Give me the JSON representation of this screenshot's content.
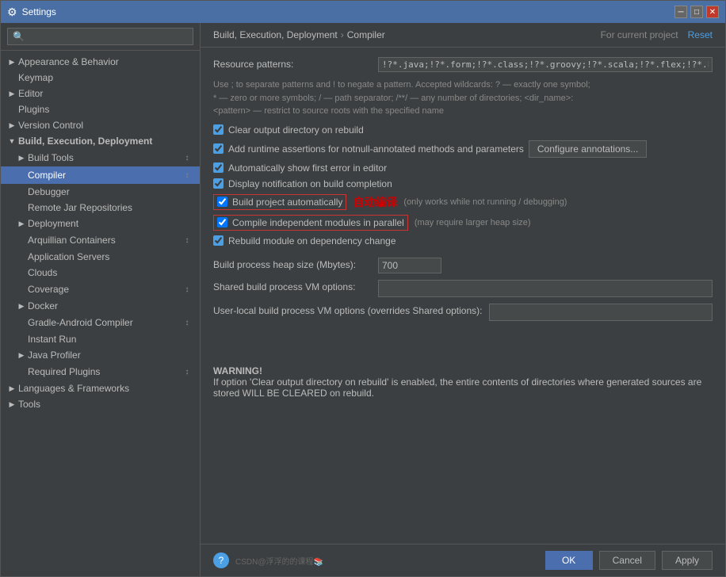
{
  "window": {
    "title": "Settings",
    "icon": "⚙"
  },
  "sidebar": {
    "search": {
      "placeholder": "🔍"
    },
    "items": [
      {
        "id": "appearance",
        "label": "Appearance & Behavior",
        "level": 0,
        "arrow": "closed",
        "selected": false
      },
      {
        "id": "keymap",
        "label": "Keymap",
        "level": 0,
        "arrow": "empty",
        "selected": false
      },
      {
        "id": "editor",
        "label": "Editor",
        "level": 0,
        "arrow": "closed",
        "selected": false
      },
      {
        "id": "plugins",
        "label": "Plugins",
        "level": 0,
        "arrow": "empty",
        "selected": false
      },
      {
        "id": "version-control",
        "label": "Version Control",
        "level": 0,
        "arrow": "closed",
        "selected": false
      },
      {
        "id": "build-exec",
        "label": "Build, Execution, Deployment",
        "level": 0,
        "arrow": "open",
        "selected": false,
        "bold": true
      },
      {
        "id": "build-tools",
        "label": "Build Tools",
        "level": 1,
        "arrow": "closed",
        "selected": false,
        "sync": true
      },
      {
        "id": "compiler",
        "label": "Compiler",
        "level": 1,
        "arrow": "empty",
        "selected": true,
        "sync": true
      },
      {
        "id": "debugger",
        "label": "Debugger",
        "level": 1,
        "arrow": "empty",
        "selected": false
      },
      {
        "id": "remote-jar",
        "label": "Remote Jar Repositories",
        "level": 1,
        "arrow": "empty",
        "selected": false
      },
      {
        "id": "deployment",
        "label": "Deployment",
        "level": 1,
        "arrow": "closed",
        "selected": false
      },
      {
        "id": "arquillian",
        "label": "Arquillian Containers",
        "level": 1,
        "arrow": "empty",
        "selected": false,
        "sync": true
      },
      {
        "id": "app-servers",
        "label": "Application Servers",
        "level": 1,
        "arrow": "empty",
        "selected": false
      },
      {
        "id": "clouds",
        "label": "Clouds",
        "level": 1,
        "arrow": "empty",
        "selected": false
      },
      {
        "id": "coverage",
        "label": "Coverage",
        "level": 1,
        "arrow": "empty",
        "selected": false,
        "sync": true
      },
      {
        "id": "docker",
        "label": "Docker",
        "level": 1,
        "arrow": "closed",
        "selected": false
      },
      {
        "id": "gradle-android",
        "label": "Gradle-Android Compiler",
        "level": 1,
        "arrow": "empty",
        "selected": false,
        "sync": true
      },
      {
        "id": "instant-run",
        "label": "Instant Run",
        "level": 1,
        "arrow": "empty",
        "selected": false
      },
      {
        "id": "java-profiler",
        "label": "Java Profiler",
        "level": 1,
        "arrow": "closed",
        "selected": false
      },
      {
        "id": "required-plugins",
        "label": "Required Plugins",
        "level": 1,
        "arrow": "empty",
        "selected": false,
        "sync": true
      },
      {
        "id": "languages",
        "label": "Languages & Frameworks",
        "level": 0,
        "arrow": "closed",
        "selected": false
      },
      {
        "id": "tools",
        "label": "Tools",
        "level": 0,
        "arrow": "closed",
        "selected": false
      }
    ]
  },
  "header": {
    "breadcrumb1": "Build, Execution, Deployment",
    "arrow": "›",
    "breadcrumb2": "Compiler",
    "for_project": "For current project",
    "reset": "Reset"
  },
  "form": {
    "resource_patterns_label": "Resource patterns:",
    "resource_patterns_value": "!?*.java;!?*.form;!?*.class;!?*.groovy;!?*.scala;!?*.flex;!?*.kt;!?*.clj;!?*.aj",
    "hint1": "Use ; to separate patterns and ! to negate a pattern. Accepted wildcards: ? — exactly one symbol;",
    "hint2": "* — zero or more symbols; / — path separator; /**/ — any number of directories; <dir_name>:",
    "hint3": "<pattern> — restrict to source roots with the specified name",
    "checks": [
      {
        "id": "clear-output",
        "label": "Clear output directory on rebuild",
        "checked": true,
        "highlighted": false
      },
      {
        "id": "runtime-assertions",
        "label": "Add runtime assertions for notnull-annotated methods and parameters",
        "checked": true,
        "highlighted": false,
        "has_button": true,
        "button_label": "Configure annotations..."
      },
      {
        "id": "show-first-error",
        "label": "Automatically show first error in editor",
        "checked": true,
        "highlighted": false
      },
      {
        "id": "display-notification",
        "label": "Display notification on build completion",
        "checked": true,
        "highlighted": false
      }
    ],
    "build_automatically_label": "Build project automatically",
    "build_automatically_checked": true,
    "auto_compile_note": "自动编译",
    "build_automatically_note": "(only works while not running / debugging)",
    "compile_parallel_label": "Compile independent modules in parallel",
    "compile_parallel_checked": true,
    "compile_parallel_note": "(may require larger heap size)",
    "rebuild_module_label": "Rebuild module on dependency change",
    "rebuild_module_checked": true,
    "heap_size_label": "Build process heap size (Mbytes):",
    "heap_size_value": "700",
    "shared_vm_label": "Shared build process VM options:",
    "shared_vm_value": "",
    "user_local_vm_label": "User-local build process VM options (overrides Shared options):",
    "user_local_vm_value": "",
    "warning_title": "WARNING!",
    "warning_text": "If option 'Clear output directory on rebuild' is enabled, the entire contents of directories where generated sources are stored WILL BE CLEARED on rebuild."
  },
  "footer": {
    "watermark": "CSDN@浮浮的的课程📚",
    "ok": "OK",
    "cancel": "Cancel",
    "apply": "Apply"
  }
}
